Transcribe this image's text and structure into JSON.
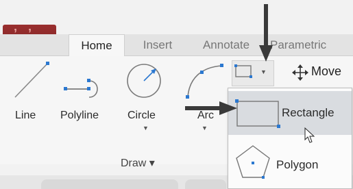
{
  "ribbon": {
    "tabs": [
      {
        "label": "Home",
        "active": true
      },
      {
        "label": "Insert",
        "active": false
      },
      {
        "label": "Annotate",
        "active": false
      },
      {
        "label": "Parametric",
        "active": false
      }
    ],
    "tools": {
      "line": "Line",
      "polyline": "Polyline",
      "circle": "Circle",
      "arc": "Arc",
      "move": "Move"
    },
    "panel_title": "Draw ▾"
  },
  "dropdown": {
    "items": [
      {
        "label": "Rectangle",
        "highlighted": true
      },
      {
        "label": "Polygon",
        "highlighted": false
      }
    ]
  },
  "colors": {
    "accent_blue": "#2b78d0",
    "annotation_arrow": "#3a3a3a",
    "hover": "#d9dce0"
  },
  "icons": [
    "application-menu-icon",
    "line-icon",
    "polyline-icon",
    "circle-icon",
    "arc-icon",
    "rectangle-icon",
    "move-icon",
    "polygon-icon",
    "cursor-icon",
    "annotation-arrow-down-icon",
    "annotation-arrow-right-icon"
  ]
}
